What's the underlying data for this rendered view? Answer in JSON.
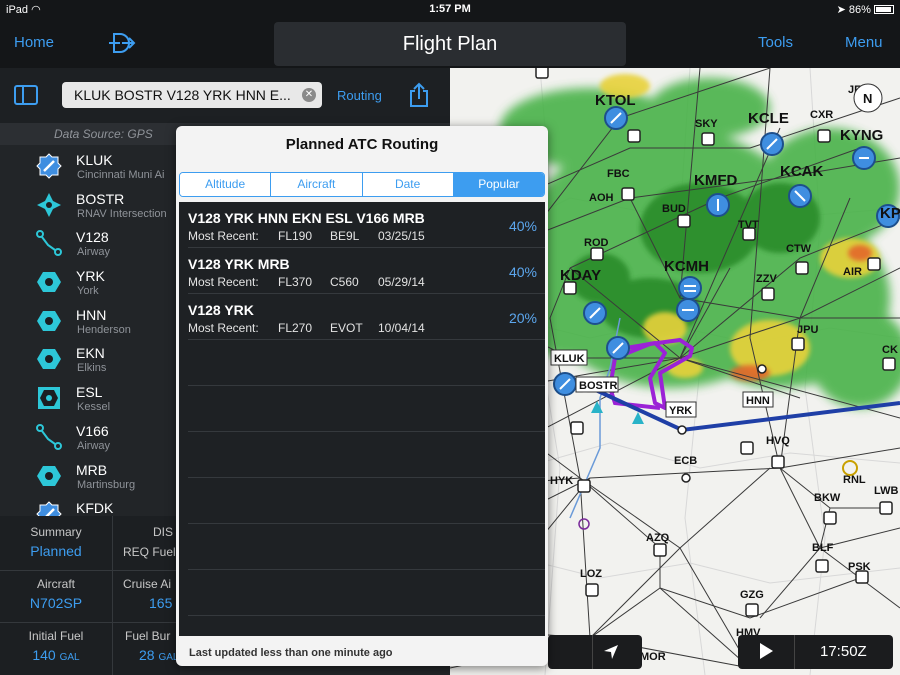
{
  "status_bar": {
    "device": "iPad",
    "time": "1:57 PM",
    "battery": "86%"
  },
  "nav": {
    "home": "Home",
    "title": "Flight Plan",
    "tools": "Tools",
    "menu": "Menu"
  },
  "route": {
    "field_value": "KLUK BOSTR V128 YRK HNN E...",
    "routing_label": "Routing"
  },
  "data_source": "Data Source: GPS",
  "waypoints": [
    {
      "name": "KLUK",
      "desc": "Cincinnati Muni Ai",
      "icon": "airport-icon"
    },
    {
      "name": "BOSTR",
      "desc": "RNAV Intersection",
      "icon": "rnav-intersection-icon"
    },
    {
      "name": "V128",
      "desc": "Airway",
      "icon": "airway-icon"
    },
    {
      "name": "YRK",
      "desc": "York",
      "icon": "vor-icon"
    },
    {
      "name": "HNN",
      "desc": "Henderson",
      "icon": "vor-icon"
    },
    {
      "name": "EKN",
      "desc": "Elkins",
      "icon": "vor-icon"
    },
    {
      "name": "ESL",
      "desc": "Kessel",
      "icon": "vortac-icon"
    },
    {
      "name": "V166",
      "desc": "Airway",
      "icon": "airway-icon"
    },
    {
      "name": "MRB",
      "desc": "Martinsburg",
      "icon": "vor-icon"
    },
    {
      "name": "KFDK",
      "desc": "",
      "icon": "airport-icon"
    }
  ],
  "summary": {
    "summary_label": "Summary",
    "summary_value": "Planned",
    "dist_label": "DIS",
    "req_fuel_label": "REQ Fuel",
    "aircraft_label": "Aircraft",
    "aircraft_value": "N702SP",
    "cruise_label": "Cruise Ai",
    "cruise_value": "165",
    "initial_fuel_label": "Initial Fuel",
    "initial_fuel_value": "140",
    "fuel_burn_label": "Fuel Bur",
    "fuel_burn_value": "28",
    "unit_gal": "GAL"
  },
  "popover": {
    "title": "Planned ATC Routing",
    "tabs": [
      "Altitude",
      "Aircraft",
      "Date",
      "Popular"
    ],
    "active_tab": "Popular",
    "routes": [
      {
        "route": "V128 YRK HNN EKN ESL V166 MRB",
        "label": "Most Recent:",
        "altitude": "FL190",
        "aircraft": "BE9L",
        "date": "03/25/15",
        "percent": "40%"
      },
      {
        "route": "V128 YRK MRB",
        "label": "Most Recent:",
        "altitude": "FL370",
        "aircraft": "C560",
        "date": "05/29/14",
        "percent": "40%"
      },
      {
        "route": "V128 YRK",
        "label": "Most Recent:",
        "altitude": "FL270",
        "aircraft": "EVOT",
        "date": "10/04/14",
        "percent": "20%"
      }
    ],
    "footer": "Last updated less than one minute ago"
  },
  "map": {
    "labels": {
      "ktol": "KTOL",
      "kcle": "KCLE",
      "kyng": "KYNG",
      "jfn": "JFN",
      "cxr": "CXR",
      "sky": "SKY",
      "kmfd": "KMFD",
      "kcak": "KCAK",
      "fbc": "FBC",
      "aoh": "AOH",
      "bud": "BUD",
      "tvt": "TVT",
      "rod": "ROD",
      "ctw": "CTW",
      "kday": "KDAY",
      "kcmh": "KCMH",
      "zzv": "ZZV",
      "air": "AIR",
      "jpu": "JPU",
      "kluk": "KLUK",
      "bostr": "BOSTR",
      "yrk": "YRK",
      "hnn": "HNN",
      "hvq": "HVQ",
      "ecb": "ECB",
      "hyk": "HYK",
      "rnl": "RNL",
      "lwb": "LWB",
      "bkw": "BKW",
      "azq": "AZQ",
      "blf": "BLF",
      "psk": "PSK",
      "loz": "LOZ",
      "gzg": "GZG",
      "hmv": "HMV",
      "mor": "MOR",
      "ckb": "CK",
      "kp": "KP"
    },
    "north": "N",
    "clock": "17:50Z"
  },
  "colors": {
    "accent": "#3d9df0",
    "route_line": "#1f3fa6",
    "proc_line": "#9b22d6"
  }
}
